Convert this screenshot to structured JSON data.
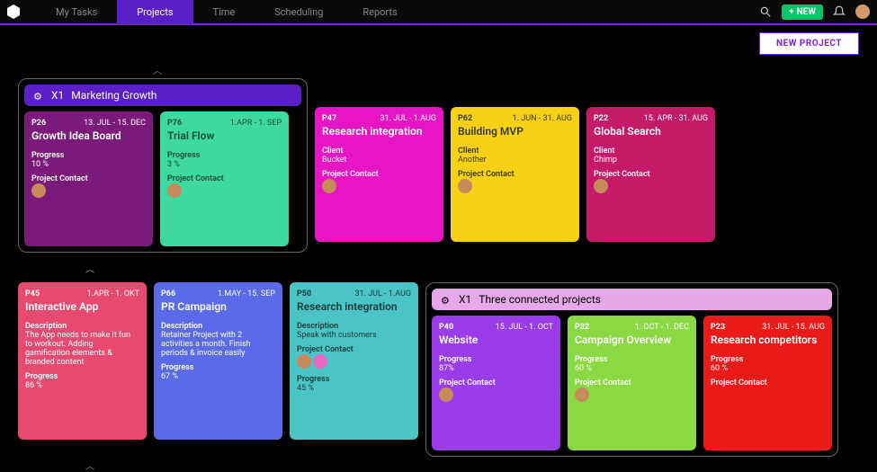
{
  "nav": {
    "items": [
      "My Tasks",
      "Projects",
      "Time",
      "Scheduling",
      "Reports"
    ],
    "activeIndex": 1
  },
  "topbar": {
    "newLabel": "NEW"
  },
  "subbar": {
    "newProject": "NEW PROJECT"
  },
  "group1": {
    "badge": "X1",
    "title": "Marketing Growth",
    "bg": "#5b1fc7"
  },
  "group2": {
    "badge": "X1",
    "title": "Three connected projects",
    "bg": "#e6a8e6"
  },
  "cards": {
    "c0": {
      "id": "P26",
      "dates": "13. JUL - 15. DEC",
      "title": "Growth Idea Board",
      "lbl1": "Progress",
      "val1": "10 %",
      "lbl2": "Project Contact",
      "bg": "#7a1a7a"
    },
    "c1": {
      "id": "P76",
      "dates": "1.APR - 1. SEP",
      "title": "Trial Flow",
      "lbl1": "Progress",
      "val1": "3 %",
      "lbl2": "Project Contact",
      "bg": "#3dd9a0",
      "fg": "#222"
    },
    "c2": {
      "id": "P47",
      "dates": "31. JUL - 1.AUG",
      "title": "Research integration",
      "lbl1": "Client",
      "val1": "Bucket",
      "lbl2": "Project Contact",
      "bg": "#e815c5"
    },
    "c3": {
      "id": "P62",
      "dates": "1. JUN - 31. AUG",
      "title": "Building MVP",
      "lbl1": "Client",
      "val1": "Another",
      "lbl2": "Project Contact",
      "bg": "#f7d117",
      "fg": "#222"
    },
    "c4": {
      "id": "P22",
      "dates": "15. APR - 31. AUG",
      "title": "Global Search",
      "lbl1": "Client",
      "val1": "Chimp",
      "lbl2": "Project Contact",
      "bg": "#c41a68"
    },
    "c5": {
      "id": "P45",
      "dates": "1.APR - 1. OKT",
      "title": "Interactive App",
      "lbl1": "Description",
      "val1": "The App needs to make it fun to workout. Adding gamification elements & branded content",
      "lbl2": "Progress",
      "val2": "86 %",
      "bg": "#e84a6f"
    },
    "c6": {
      "id": "P66",
      "dates": "1.MAY - 15. SEP",
      "title": "PR Campaign",
      "lbl1": "Description",
      "val1": "Retainer Project with 2 activities a month. Finish periods & invoice easily",
      "lbl2": "Progress",
      "val2": "67 %",
      "bg": "#5a6ae8"
    },
    "c7": {
      "id": "P50",
      "dates": "31. JUL - 1.AUG",
      "title": "Research integration",
      "lbl1": "Description",
      "val1": "Speak with customers",
      "lbl2": "Project Contact",
      "lbl3": "Progress",
      "val3": "45 %",
      "bg": "#4ac4c4",
      "fg": "#222"
    },
    "c8": {
      "id": "P40",
      "dates": "15. JUL - 1. OCT",
      "title": "Website",
      "lbl1": "Progress",
      "val1": "87%",
      "lbl2": "Project Contact",
      "bg": "#9a3de8"
    },
    "c9": {
      "id": "P32",
      "dates": "1. OCT - 1. DEC",
      "title": "Campaign Overview",
      "lbl1": "Progress",
      "val1": "60 %",
      "lbl2": "Project Contact",
      "bg": "#8ad943",
      "fg": "#fff"
    },
    "c10": {
      "id": "P23",
      "dates": "31. JUL - 15. AUG",
      "title": "Research competitors",
      "lbl1": "Progress",
      "val1": "60 %",
      "lbl2": "Project Contact",
      "bg": "#e81a1a"
    }
  }
}
